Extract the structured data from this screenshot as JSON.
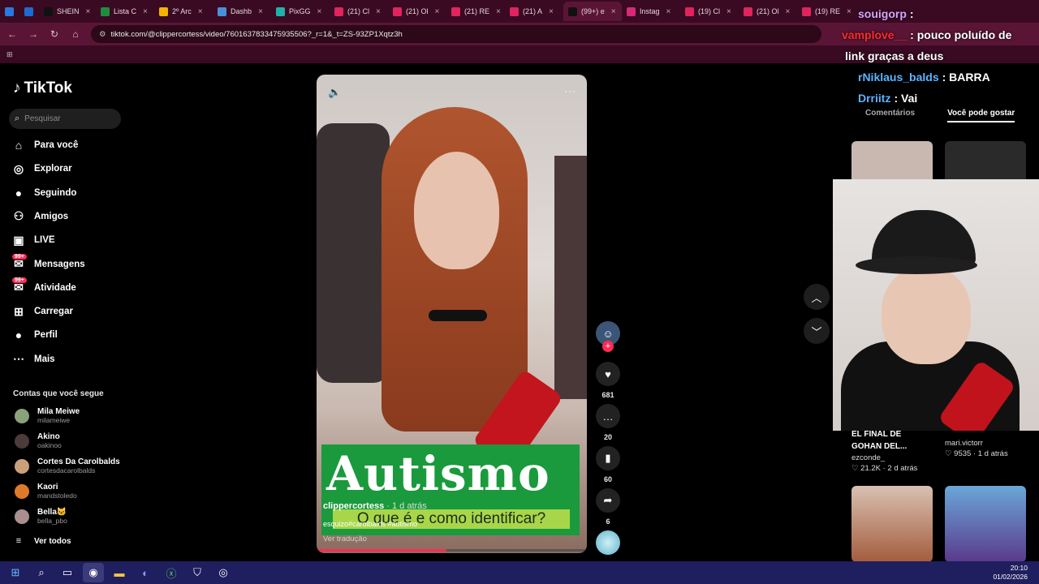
{
  "tabs": [
    {
      "label": "",
      "color": "#2a79e0"
    },
    {
      "label": "",
      "color": "#1b6bd1"
    },
    {
      "label": "SHEIN",
      "color": "#111111"
    },
    {
      "label": "Lista C",
      "color": "#1e8e3e"
    },
    {
      "label": "2º Arc",
      "color": "#f4b400"
    },
    {
      "label": "Dashb",
      "color": "#4a90d9"
    },
    {
      "label": "PixGG",
      "color": "#20b2aa"
    },
    {
      "label": "(21) Cl",
      "color": "#e0245e"
    },
    {
      "label": "(21) Ol",
      "color": "#e0245e"
    },
    {
      "label": "(21) RE",
      "color": "#e0245e"
    },
    {
      "label": "(21) A",
      "color": "#e0245e"
    },
    {
      "label": "(99+) e",
      "color": "#111111"
    },
    {
      "label": "Instag",
      "color": "#d62976"
    },
    {
      "label": "(19) Cl",
      "color": "#e0245e"
    },
    {
      "label": "(21) Ol",
      "color": "#e0245e"
    },
    {
      "label": "(19) RE",
      "color": "#e0245e"
    }
  ],
  "url": "tiktok.com/@clippercortess/video/7601637833475935506?_r=1&_t=ZS-93ZP1Xqtz3h",
  "brand": "TikTok",
  "search_placeholder": "Pesquisar",
  "nav": [
    {
      "label": "Para você",
      "icon": "home-icon"
    },
    {
      "label": "Explorar",
      "icon": "compass-icon"
    },
    {
      "label": "Seguindo",
      "icon": "following-icon"
    },
    {
      "label": "Amigos",
      "icon": "friends-icon"
    },
    {
      "label": "LIVE",
      "icon": "live-icon"
    },
    {
      "label": "Mensagens",
      "icon": "messages-icon",
      "badge": "99+"
    },
    {
      "label": "Atividade",
      "icon": "activity-icon",
      "badge": "99+"
    },
    {
      "label": "Carregar",
      "icon": "upload-icon"
    },
    {
      "label": "Perfil",
      "icon": "profile-icon"
    },
    {
      "label": "Mais",
      "icon": "more-icon"
    }
  ],
  "following_title": "Contas que você segue",
  "accounts": [
    {
      "name": "Mila Meiwe",
      "handle": "milameiwe",
      "color": "#8aa17a"
    },
    {
      "name": "Akino",
      "handle": "oakinoo",
      "color": "#4b3b3b"
    },
    {
      "name": "Cortes Da Carolbalds",
      "handle": "cortesdacarolbalds",
      "color": "#c9a07a"
    },
    {
      "name": "Kaori",
      "handle": "mandstoledo",
      "color": "#e07a2a"
    },
    {
      "name": "Bella🐱",
      "handle": "bella_pbo",
      "color": "#a98f8f"
    }
  ],
  "see_all": "Ver todos",
  "video": {
    "banner_title": "Autismo",
    "banner_sub": "O que é e como identificar?",
    "user": "clippercortess",
    "time": "· 1 d atrás",
    "tags": "esquizo#carolbalds #autismo",
    "translate": "Ver tradução",
    "progress": 0.48
  },
  "actions": {
    "likes": "681",
    "comments": "20",
    "saves": "60",
    "shares": "6"
  },
  "right": {
    "tab_comments": "Comentários",
    "tab_suggest": "Você pode gostar",
    "item1_title": "EL FINAL DE\nGOHAN DEL...",
    "item1_user": "ezconde_",
    "item1_meta": "♡ 21.2K · 2 d atrás",
    "item2_user": "mari.victorr",
    "item2_meta": "♡ 9535 · 1 d atrás"
  },
  "chat": [
    {
      "user": "souigorp",
      "text": ":",
      "user_color": "#d9a4ff"
    },
    {
      "user": "vamplove__",
      "text": ": pouco poluído de",
      "user_color": "#ff2a2a"
    },
    {
      "user": "",
      "text": "link graças a deus",
      "user_color": "#ffffff"
    },
    {
      "user": "rNiklaus_balds",
      "text": ": BARRA",
      "user_color": "#5ab4ff"
    },
    {
      "user": "Drriitz",
      "text": ": Vai",
      "user_color": "#5ab4ff"
    }
  ],
  "clock": {
    "time": "20:10",
    "date": "01/02/2026"
  }
}
